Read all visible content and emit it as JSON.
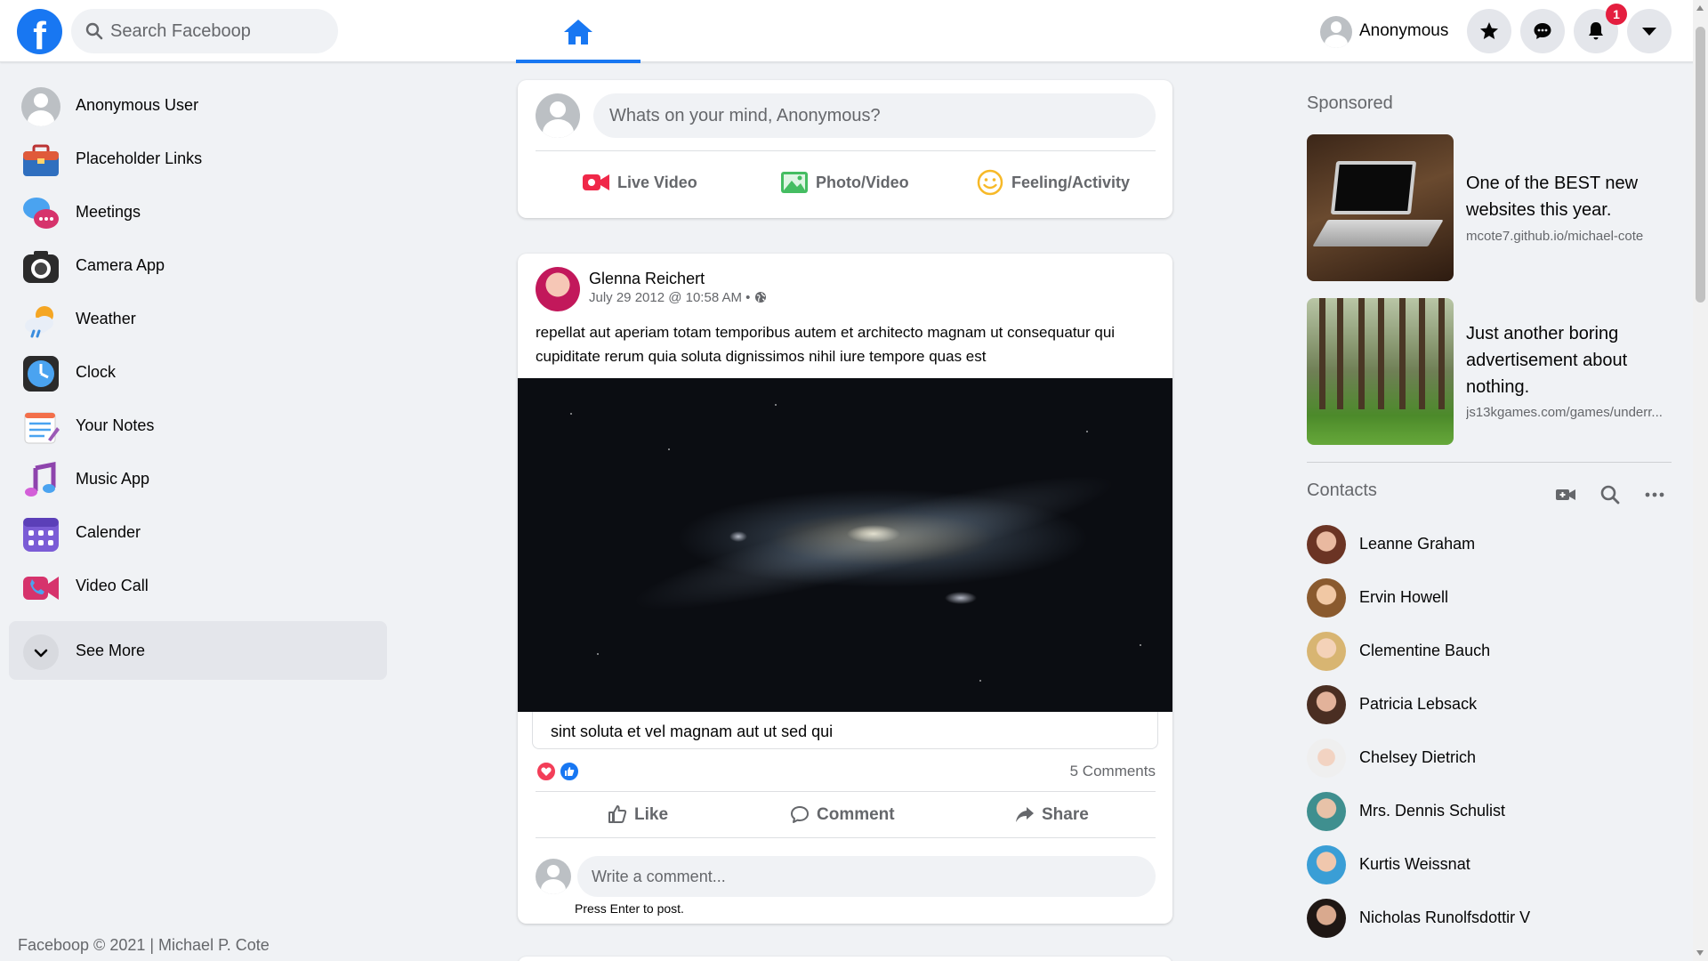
{
  "topbar": {
    "logo_letter": "f",
    "search_placeholder": "Search Faceboop",
    "profile_name": "Anonymous",
    "notifications_count": "1",
    "brand_color": "#1877f2",
    "icons": [
      "search-icon",
      "home-icon",
      "star-icon",
      "messenger-icon",
      "bell-icon",
      "caret-down-icon"
    ]
  },
  "left_nav": {
    "items": [
      {
        "label": "Anonymous User",
        "icon": "user-avatar-icon"
      },
      {
        "label": "Placeholder Links",
        "icon": "briefcase-icon"
      },
      {
        "label": "Meetings",
        "icon": "chat-bubbles-icon"
      },
      {
        "label": "Camera App",
        "icon": "camera-icon"
      },
      {
        "label": "Weather",
        "icon": "weather-icon"
      },
      {
        "label": "Clock",
        "icon": "clock-icon"
      },
      {
        "label": "Your Notes",
        "icon": "notes-icon"
      },
      {
        "label": "Music App",
        "icon": "music-icon"
      },
      {
        "label": "Calender",
        "icon": "calendar-icon"
      },
      {
        "label": "Video Call",
        "icon": "video-call-icon"
      }
    ],
    "see_more": "See More"
  },
  "footer": "Faceboop © 2021 | Michael P. Cote",
  "composer": {
    "placeholder": "Whats on your mind, Anonymous?",
    "actions": [
      "Live Video",
      "Photo/Video",
      "Feeling/Activity"
    ]
  },
  "post": {
    "author": "Glenna Reichert",
    "timestamp": "July 29 2012 @ 10:58 AM •",
    "body": "repellat aut aperiam totam temporibus autem et architecto magnam ut consequatur qui cupiditate rerum quia soluta dignissimos nihil iure tempore quas est",
    "caption": "sint soluta et vel magnam aut ut sed qui",
    "comments_count": "5 Comments",
    "actions": [
      "Like",
      "Comment",
      "Share"
    ],
    "comment_placeholder": "Write a comment...",
    "hint": "Press Enter to post."
  },
  "sponsored": {
    "title": "Sponsored",
    "ads": [
      {
        "text": "One of the BEST new websites this year.",
        "link": "mcote7.github.io/michael-cote"
      },
      {
        "text": "Just another boring advertisement about nothing.",
        "link": "js13kgames.com/games/underr..."
      }
    ]
  },
  "contacts": {
    "title": "Contacts",
    "people": [
      "Leanne Graham",
      "Ervin Howell",
      "Clementine Bauch",
      "Patricia Lebsack",
      "Chelsey Dietrich",
      "Mrs. Dennis Schulist",
      "Kurtis Weissnat",
      "Nicholas Runolfsdottir V"
    ]
  }
}
